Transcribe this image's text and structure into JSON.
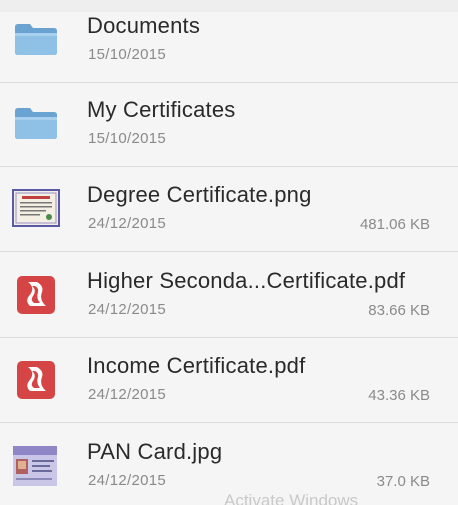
{
  "files": [
    {
      "name": "Documents",
      "date": "15/10/2015",
      "size": "",
      "icon": "folder-icon"
    },
    {
      "name": "My Certificates",
      "date": "15/10/2015",
      "size": "",
      "icon": "folder-icon"
    },
    {
      "name": "Degree Certificate.png",
      "date": "24/12/2015",
      "size": "481.06 KB",
      "icon": "certificate-image-icon"
    },
    {
      "name": "Higher Seconda...Certificate.pdf",
      "date": "24/12/2015",
      "size": "83.66 KB",
      "icon": "pdf-icon"
    },
    {
      "name": "Income Certificate.pdf",
      "date": "24/12/2015",
      "size": "43.36 KB",
      "icon": "pdf-icon"
    },
    {
      "name": "PAN Card.jpg",
      "date": "24/12/2015",
      "size": "37.0 KB",
      "icon": "pan-card-image-icon"
    }
  ],
  "watermark": "Activate Windows",
  "colors": {
    "folder": "#7fb0d8",
    "pdf_red": "#d64545"
  }
}
